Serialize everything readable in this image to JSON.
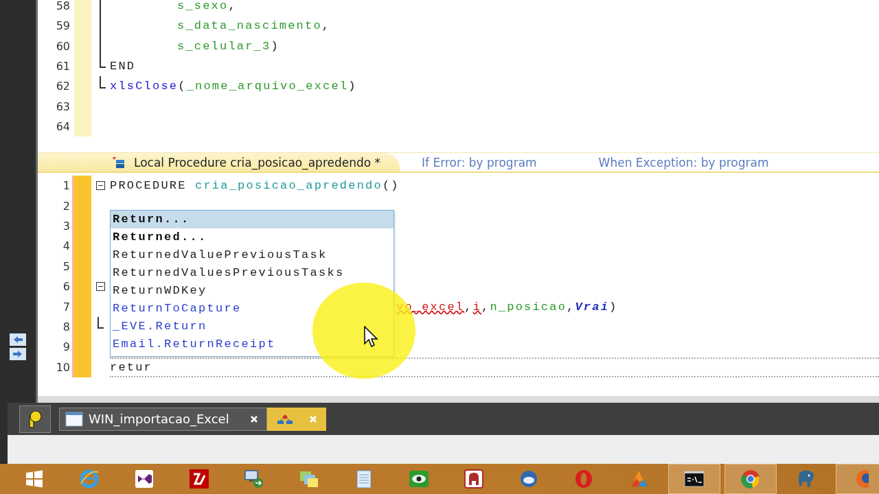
{
  "upper_code": [
    {
      "number": "58",
      "kind": "inner",
      "segments": [
        {
          "text": "s_sexo",
          "kind": "var"
        },
        {
          "text": ",",
          "kind": "plain"
        }
      ]
    },
    {
      "number": "59",
      "kind": "inner",
      "segments": [
        {
          "text": "s_data_nascimento",
          "kind": "var"
        },
        {
          "text": ",",
          "kind": "plain"
        }
      ]
    },
    {
      "number": "60",
      "kind": "inner",
      "segments": [
        {
          "text": "s_celular_3",
          "kind": "var"
        },
        {
          "text": ")",
          "kind": "plain"
        }
      ]
    },
    {
      "number": "61",
      "kind": "end",
      "segments": [
        {
          "text": "END",
          "kind": "keyword"
        }
      ]
    },
    {
      "number": "62",
      "kind": "end",
      "segments": [
        {
          "text": "xlsClose",
          "kind": "func"
        },
        {
          "text": "(",
          "kind": "plain"
        },
        {
          "text": "_nome_arquivo_excel",
          "kind": "var"
        },
        {
          "text": ")",
          "kind": "plain"
        }
      ]
    },
    {
      "number": "63",
      "kind": "plain"
    },
    {
      "number": "64",
      "kind": "plain"
    }
  ],
  "procedure_header": {
    "title": "Local Procedure cria_posicao_apredendo *",
    "if_error": "If Error: by program",
    "when_exception": "When Exception: by program"
  },
  "lower_code": [
    {
      "number": "1",
      "kind": "plain",
      "fold_marker": true,
      "segments": [
        {
          "text": "PROCEDURE ",
          "kind": "keyword"
        },
        {
          "text": "cria_posicao_apredendo",
          "kind": "proc"
        },
        {
          "text": "()",
          "kind": "plain"
        }
      ]
    },
    {
      "number": "2",
      "kind": "plain",
      "fold_marker": false
    },
    {
      "number": "3",
      "kind": "plain",
      "fold_marker": false
    },
    {
      "number": "4",
      "kind": "plain",
      "fold_marker": false
    },
    {
      "number": "5",
      "kind": "plain",
      "fold_marker": false
    },
    {
      "number": "6",
      "kind": "plain",
      "fold_marker": true
    },
    {
      "number": "7",
      "kind": "tail",
      "fold_marker": false,
      "segments": [
        {
          "text": "vo_excel",
          "kind": "error"
        },
        {
          "text": ",",
          "kind": "plain"
        },
        {
          "text": "i",
          "kind": "error"
        },
        {
          "text": ",",
          "kind": "plain"
        },
        {
          "text": "n_posicao",
          "kind": "var"
        },
        {
          "text": ",",
          "kind": "plain"
        },
        {
          "text": "Vrai",
          "kind": "constant"
        },
        {
          "text": ")",
          "kind": "plain"
        }
      ]
    },
    {
      "number": "8",
      "kind": "end",
      "fold_marker": false
    },
    {
      "number": "9",
      "kind": "plain",
      "fold_marker": false
    },
    {
      "number": "10",
      "kind": "editing",
      "fold_marker": false,
      "segments": [
        {
          "text": "retur",
          "kind": "plain"
        }
      ]
    }
  ],
  "completion_list": [
    {
      "text": "Return...",
      "kind": "template",
      "selected": true
    },
    {
      "text": "Returned...",
      "kind": "template",
      "selected": false
    },
    {
      "text": "ReturnedValuePreviousTask",
      "kind": "plain",
      "selected": false
    },
    {
      "text": "ReturnedValuesPreviousTasks",
      "kind": "plain",
      "selected": false
    },
    {
      "text": "ReturnWDKey",
      "kind": "plain",
      "selected": false
    },
    {
      "text": "ReturnToCapture",
      "kind": "link",
      "selected": false
    },
    {
      "text": "_EVE.Return",
      "kind": "link",
      "selected": false
    },
    {
      "text": "Email.ReturnReceipt",
      "kind": "link",
      "selected": false
    }
  ],
  "document_tabs": [
    {
      "label": "WIN_importacao_Excel",
      "kind": "window",
      "selected": false
    },
    {
      "kind": "diagram",
      "selected": true
    }
  ],
  "taskbar": [
    {
      "kind": "start",
      "active": false
    },
    {
      "kind": "ie",
      "active": false
    },
    {
      "kind": "vs",
      "active": false
    },
    {
      "kind": "filezilla",
      "active": false
    },
    {
      "kind": "remote",
      "active": false
    },
    {
      "kind": "notes",
      "active": false
    },
    {
      "kind": "notepad",
      "active": false
    },
    {
      "kind": "eye",
      "active": false
    },
    {
      "kind": "access",
      "active": false
    },
    {
      "kind": "mail",
      "active": false
    },
    {
      "kind": "opera",
      "active": false
    },
    {
      "kind": "triangle",
      "active": false
    },
    {
      "kind": "cmd",
      "active": true
    },
    {
      "kind": "chrome",
      "active": true
    },
    {
      "kind": "elephant",
      "active": false
    },
    {
      "kind": "firefox",
      "active": true
    }
  ]
}
